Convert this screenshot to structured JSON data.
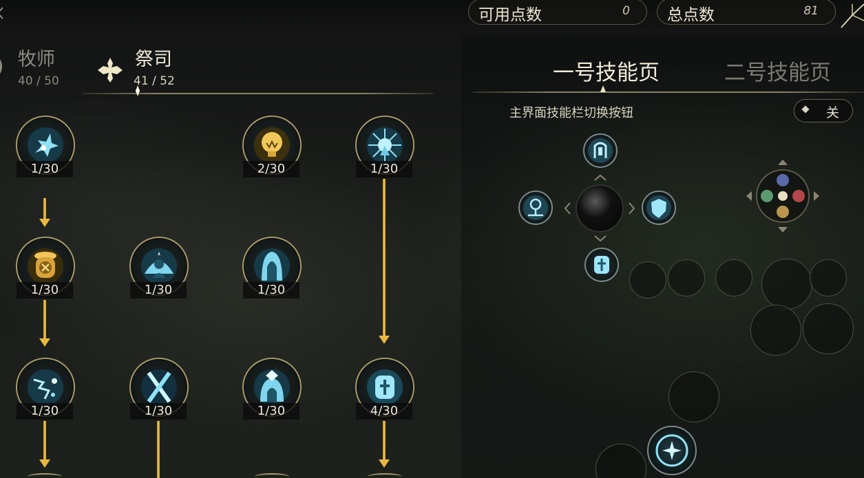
{
  "topbar": {
    "available_points_label": "可用点数",
    "available_points_value": "0",
    "total_points_label": "总点数",
    "total_points_value": "81"
  },
  "class_tabs": [
    {
      "name": "牧师",
      "count": "40 / 50",
      "active": false
    },
    {
      "name": "祭司",
      "count": "41 / 52",
      "active": true
    }
  ],
  "skill_tree": {
    "nodes": [
      {
        "id": "r1c1",
        "level": "1/30",
        "icon": "shatter-burst-icon"
      },
      {
        "id": "r1c3",
        "level": "2/30",
        "icon": "golden-lightbulb-icon"
      },
      {
        "id": "r1c4",
        "level": "1/30",
        "icon": "radiant-sunburst-icon"
      },
      {
        "id": "r2c1",
        "level": "1/30",
        "icon": "golden-totem-icon"
      },
      {
        "id": "r2c2",
        "level": "1/30",
        "icon": "divine-shield-figure-icon"
      },
      {
        "id": "r2c3",
        "level": "1/30",
        "icon": "hooded-figure-icon"
      },
      {
        "id": "r3c1",
        "level": "1/30",
        "icon": "lightning-sparks-icon"
      },
      {
        "id": "r3c2",
        "level": "1/30",
        "icon": "crossed-blades-icon"
      },
      {
        "id": "r3c3",
        "level": "1/30",
        "icon": "crowned-figure-icon"
      },
      {
        "id": "r3c4",
        "level": "4/30",
        "icon": "cross-tablet-icon"
      }
    ]
  },
  "right_panel": {
    "page_tabs": [
      {
        "label": "一号技能页",
        "active": true
      },
      {
        "label": "二号技能页",
        "active": false
      }
    ],
    "toggle": {
      "label": "主界面技能栏切换按钮",
      "state": "关"
    }
  },
  "colors": {
    "gold": "#e8b840",
    "ring": "#a99b6c",
    "skill_blue": "#7fd6ee",
    "text": "#ece6d4"
  }
}
